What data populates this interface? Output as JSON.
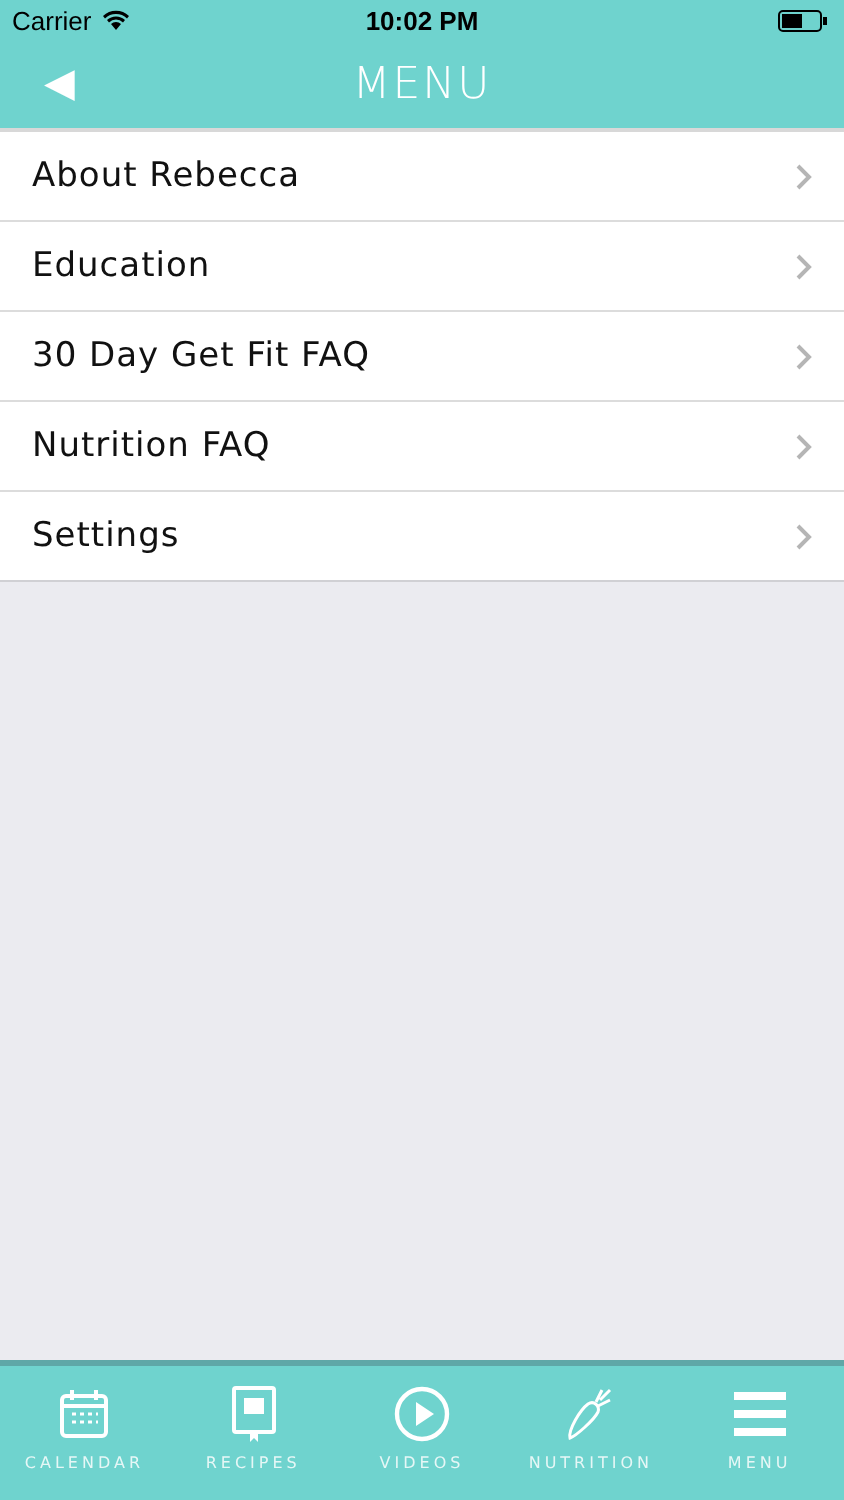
{
  "status_bar": {
    "carrier": "Carrier",
    "time": "10:02 PM"
  },
  "nav_bar": {
    "back": "◀",
    "title": "MENU"
  },
  "menu_items": [
    {
      "label": "About Rebecca"
    },
    {
      "label": "Education"
    },
    {
      "label": "30 Day Get Fit FAQ"
    },
    {
      "label": "Nutrition FAQ"
    },
    {
      "label": "Settings"
    }
  ],
  "tab_bar": [
    {
      "kind": "calendar",
      "label": "CALENDAR"
    },
    {
      "kind": "recipes",
      "label": "RECIPES"
    },
    {
      "kind": "videos",
      "label": "VIDEOS"
    },
    {
      "kind": "nutrition",
      "label": "NUTRITION"
    },
    {
      "kind": "menu",
      "label": "MENU"
    }
  ]
}
